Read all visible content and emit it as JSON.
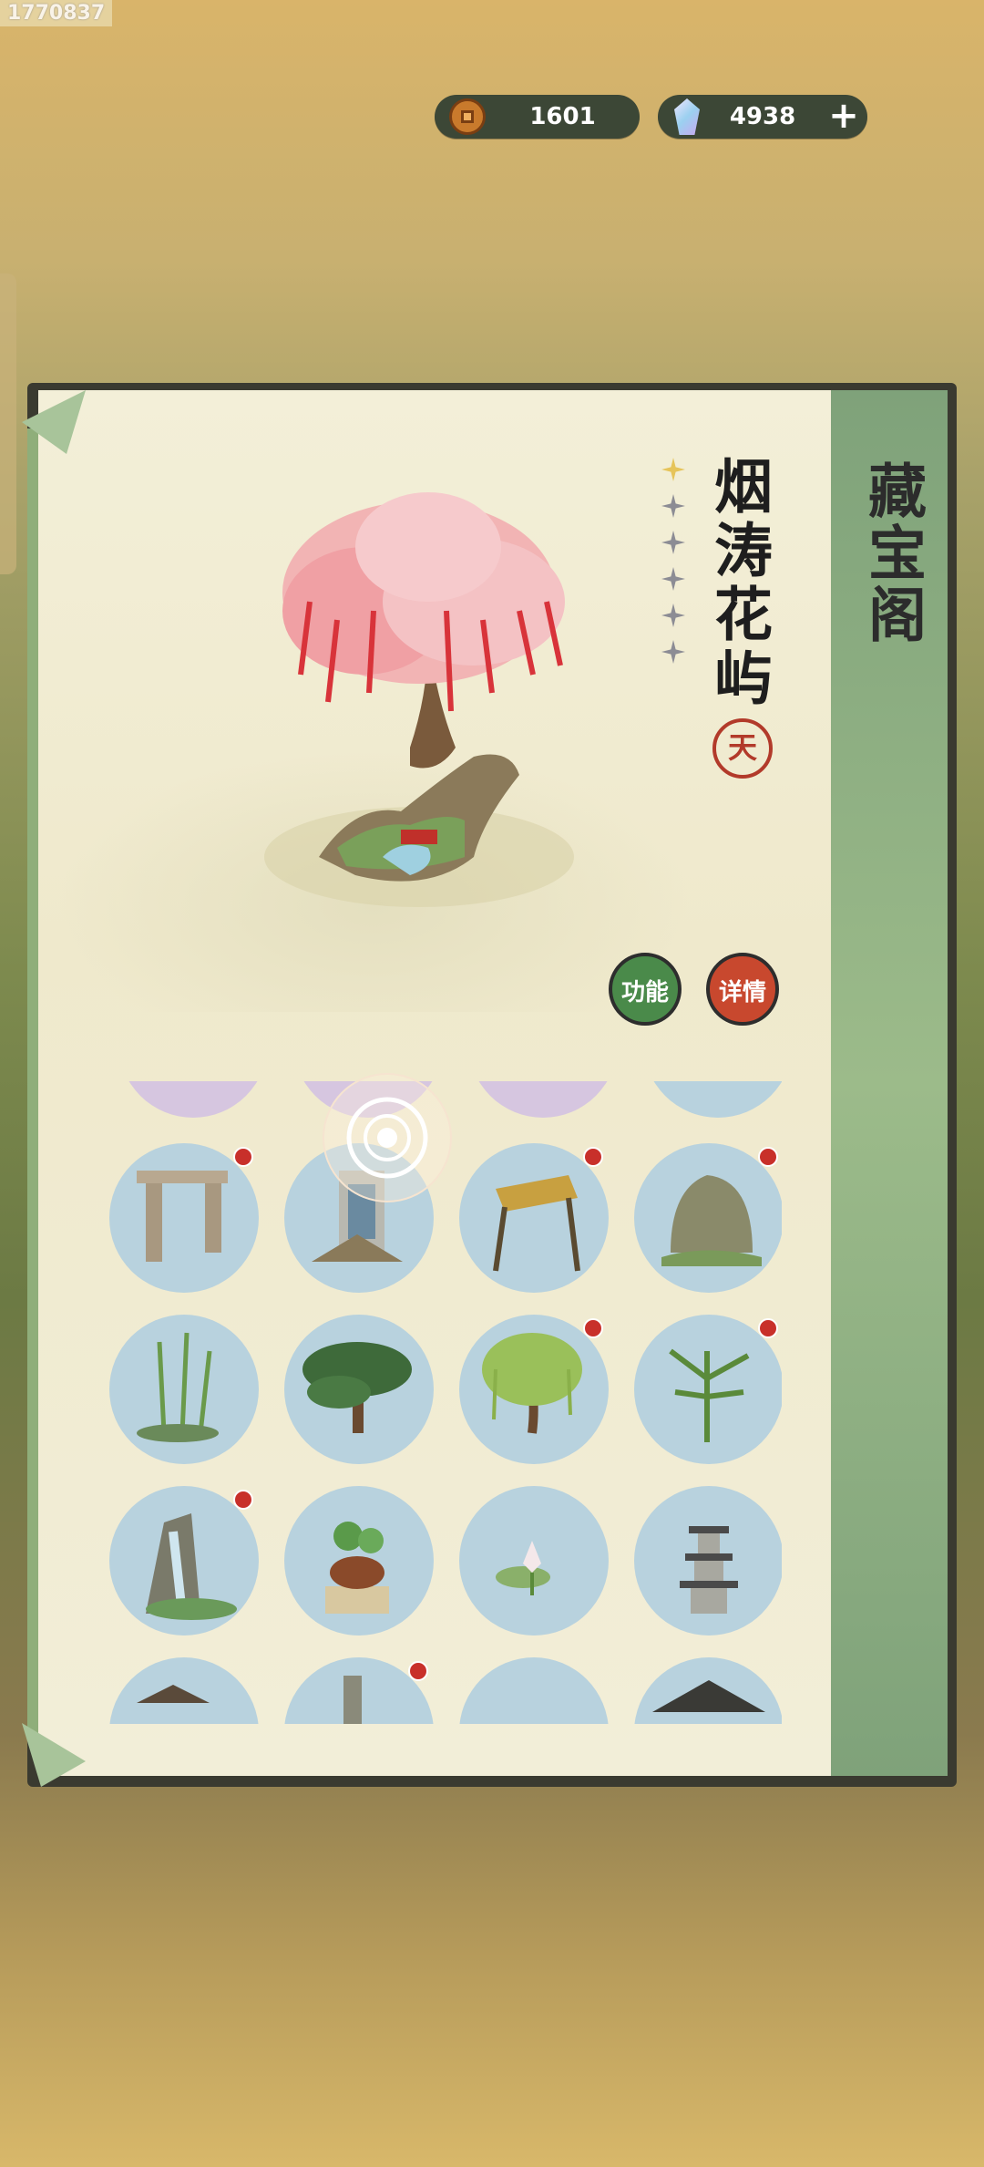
{
  "watermark": "1770837",
  "currency": {
    "coins": "1601",
    "gems": "4938",
    "coin_icon": "copper-coin",
    "gem_icon": "crystal",
    "add_label": "+"
  },
  "panel": {
    "title": "藏宝阁",
    "item_name": "烟涛花屿",
    "stars_total": 6,
    "stars_filled": 1,
    "grade_seal": "天",
    "buttons": {
      "function": "功能",
      "detail": "详情"
    }
  },
  "colors": {
    "paper": "#f3efd8",
    "green_strip": "#7fa27a",
    "item_circle": "#b8d2de",
    "badge": "#c8302a",
    "function_btn": "#4a8a4a",
    "detail_btn": "#c8482e"
  },
  "grid_items": [
    {
      "name": "top-partial-1",
      "badge": false
    },
    {
      "name": "top-partial-2",
      "badge": false
    },
    {
      "name": "top-partial-3",
      "badge": false
    },
    {
      "name": "top-partial-4",
      "badge": false
    },
    {
      "name": "stone-gate",
      "badge": true
    },
    {
      "name": "stele-shrine",
      "badge": false
    },
    {
      "name": "thatched-well",
      "badge": true
    },
    {
      "name": "moss-rock",
      "badge": true
    },
    {
      "name": "bamboo-grove",
      "badge": false
    },
    {
      "name": "pine-tree",
      "badge": false
    },
    {
      "name": "willow-tree",
      "badge": true
    },
    {
      "name": "palm-plant",
      "badge": true
    },
    {
      "name": "waterfall-rock",
      "badge": true
    },
    {
      "name": "lotus-pot",
      "badge": false
    },
    {
      "name": "lotus-flower",
      "badge": false
    },
    {
      "name": "stone-pagoda",
      "badge": false
    },
    {
      "name": "bottom-partial-1",
      "badge": false
    },
    {
      "name": "bottom-partial-2",
      "badge": true
    },
    {
      "name": "bottom-partial-3",
      "badge": false
    },
    {
      "name": "bottom-partial-4",
      "badge": false
    }
  ]
}
